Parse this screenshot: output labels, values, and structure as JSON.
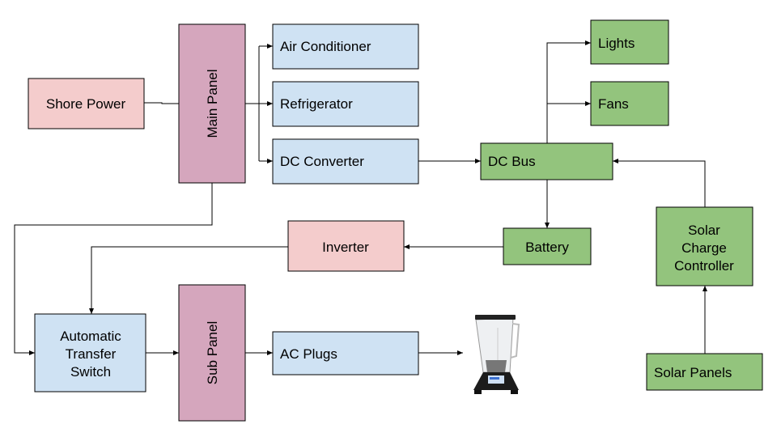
{
  "colors": {
    "pink": "#f4cccc",
    "purple": "#d5a6bd",
    "blue": "#cfe2f3",
    "green": "#93c47d"
  },
  "nodes": {
    "shore_power": "Shore Power",
    "main_panel": "Main Panel",
    "air_conditioner": "Air Conditioner",
    "refrigerator": "Refrigerator",
    "dc_converter": "DC Converter",
    "dc_bus": "DC Bus",
    "lights": "Lights",
    "fans": "Fans",
    "battery": "Battery",
    "inverter": "Inverter",
    "solar_charge_controller": [
      "Solar",
      "Charge",
      "Controller"
    ],
    "automatic_transfer_switch": [
      "Automatic",
      "Transfer",
      "Switch"
    ],
    "sub_panel": "Sub Panel",
    "ac_plugs": "AC Plugs",
    "solar_panels": "Solar Panels"
  },
  "icons": {
    "appliance": "blender-icon"
  }
}
